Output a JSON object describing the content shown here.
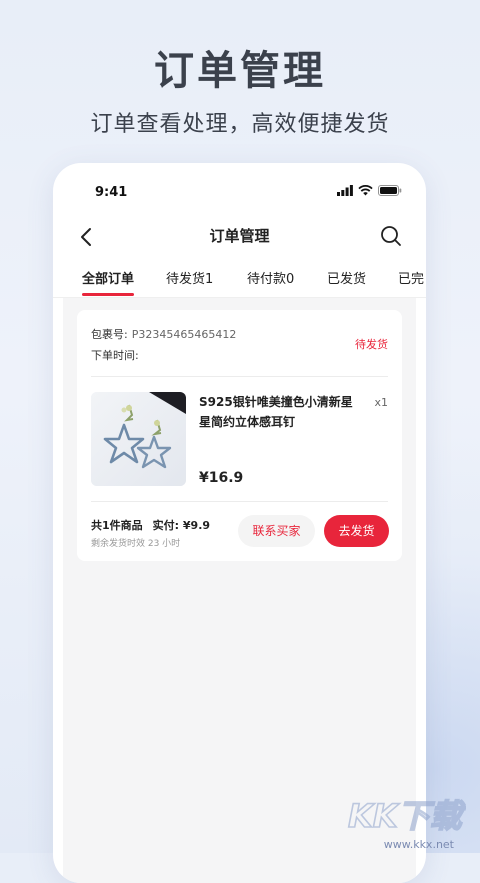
{
  "promo": {
    "title": "订单管理",
    "subtitle": "订单查看处理，高效便捷发货"
  },
  "status_bar": {
    "time": "9:41",
    "icons": [
      "signal-icon",
      "wifi-icon",
      "battery-icon"
    ]
  },
  "nav": {
    "title": "订单管理",
    "back_icon": "chevron-left-icon",
    "search_icon": "search-icon"
  },
  "tabs": [
    {
      "label": "全部订单",
      "active": true
    },
    {
      "label": "待发货1",
      "active": false
    },
    {
      "label": "待付款0",
      "active": false
    },
    {
      "label": "已发货",
      "active": false
    },
    {
      "label": "已完",
      "active": false
    }
  ],
  "order": {
    "package_label": "包裹号:",
    "package_no": "P32345465465412",
    "time_label": "下单时间:",
    "status": "待发货",
    "product": {
      "name": "S925银针唯美撞色小清新星星简约立体感耳钉",
      "qty": "x1",
      "price": "¥16.9"
    },
    "summary_count": "共1件商品",
    "summary_paid": "实付: ¥9.9",
    "remaining": "剩余发货时效 23 小时",
    "btn_contact": "联系买家",
    "btn_ship": "去发货"
  },
  "watermark": {
    "url": "www.kkx.net"
  },
  "colors": {
    "accent": "#e8253b",
    "text": "#222222",
    "promo_text": "#3b414c"
  }
}
